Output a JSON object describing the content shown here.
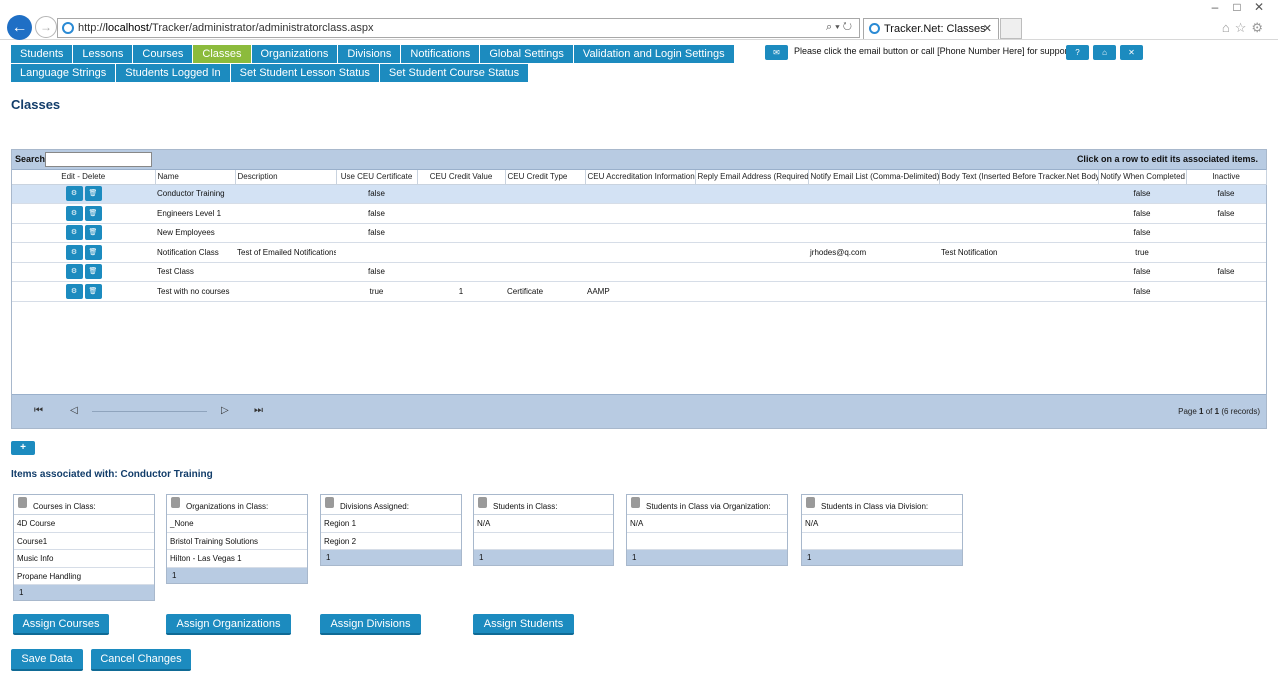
{
  "browser": {
    "url_prefix": "http://",
    "url_host": "localhost",
    "url_path": "/Tracker/administrator/administratorclass.aspx",
    "tab_title": "Tracker.Net: Classes"
  },
  "nav": {
    "row1": [
      "Students",
      "Lessons",
      "Courses",
      "Classes",
      "Organizations",
      "Divisions",
      "Notifications",
      "Global Settings",
      "Validation and Login Settings"
    ],
    "row2": [
      "Language Strings",
      "Students Logged In",
      "Set Student Lesson Status",
      "Set Student Course Status"
    ],
    "active": "Classes"
  },
  "support": {
    "text": "Please click the email button or call [Phone Number Here] for support.",
    "help_label": "?",
    "home_label": "⌂",
    "close_label": "✕"
  },
  "page_title": "Classes",
  "grid": {
    "search_label": "Search:",
    "search_value": "",
    "hint": "Click on a row to edit its associated items.",
    "columns": [
      "Edit - Delete",
      "Name",
      "Description",
      "Use CEU Certificate",
      "CEU Credit Value",
      "CEU Credit Type",
      "CEU Accreditation Information",
      "Reply Email Address (Required)",
      "Notify Email List (Comma-Delimited)",
      "Body Text (Inserted Before Tracker.Net Body)",
      "Notify When Completed",
      "Inactive"
    ],
    "rows": [
      {
        "name": "Conductor Training",
        "description": "",
        "use_ceu": "false",
        "ceu_value": "",
        "ceu_type": "",
        "ceu_accred": "",
        "reply_email": "",
        "notify_list": "",
        "body_text": "",
        "notify_completed": "false",
        "inactive": "false"
      },
      {
        "name": "Engineers Level 1",
        "description": "",
        "use_ceu": "false",
        "ceu_value": "",
        "ceu_type": "",
        "ceu_accred": "",
        "reply_email": "",
        "notify_list": "",
        "body_text": "",
        "notify_completed": "false",
        "inactive": "false"
      },
      {
        "name": "New Employees",
        "description": "",
        "use_ceu": "false",
        "ceu_value": "",
        "ceu_type": "",
        "ceu_accred": "",
        "reply_email": "",
        "notify_list": "",
        "body_text": "",
        "notify_completed": "false",
        "inactive": ""
      },
      {
        "name": "Notification Class",
        "description": "Test of Emailed Notifications",
        "use_ceu": "",
        "ceu_value": "",
        "ceu_type": "",
        "ceu_accred": "",
        "reply_email": "",
        "notify_list": "jrhodes@q.com",
        "body_text": "Test Notification",
        "notify_completed": "true",
        "inactive": ""
      },
      {
        "name": "Test Class",
        "description": "",
        "use_ceu": "false",
        "ceu_value": "",
        "ceu_type": "",
        "ceu_accred": "",
        "reply_email": "",
        "notify_list": "",
        "body_text": "",
        "notify_completed": "false",
        "inactive": "false"
      },
      {
        "name": "Test with no courses",
        "description": "",
        "use_ceu": "true",
        "ceu_value": "1",
        "ceu_type": "Certificate",
        "ceu_accred": "AAMP",
        "reply_email": "",
        "notify_list": "",
        "body_text": "",
        "notify_completed": "false",
        "inactive": ""
      }
    ],
    "pager": {
      "page_label": "Page",
      "page": "1",
      "of_label": "of",
      "total_pages": "1",
      "records": "(6 records)"
    }
  },
  "add_button_label": "+",
  "assoc_title": "Items associated with: Conductor Training",
  "lists": [
    {
      "title": "Courses in Class:",
      "items": [
        "4D Course",
        "Course1",
        "Music Info",
        "Propane Handling"
      ],
      "footer": "1"
    },
    {
      "title": "Organizations in Class:",
      "items": [
        "_None",
        "Bristol Training Solutions",
        "Hilton - Las Vegas 1"
      ],
      "footer": "1"
    },
    {
      "title": "Divisions Assigned:",
      "items": [
        "Region 1",
        "Region 2"
      ],
      "footer": "1"
    },
    {
      "title": "Students in Class:",
      "items": [
        "N/A",
        ""
      ],
      "footer": "1"
    },
    {
      "title": "Students in Class via Organization:",
      "items": [
        "N/A",
        ""
      ],
      "footer": "1"
    },
    {
      "title": "Students in Class via Division:",
      "items": [
        "N/A",
        ""
      ],
      "footer": "1"
    }
  ],
  "buttons": {
    "assign_courses": "Assign Courses",
    "assign_organizations": "Assign Organizations",
    "assign_divisions": "Assign Divisions",
    "assign_students": "Assign Students",
    "save": "Save Data",
    "cancel": "Cancel Changes"
  },
  "colors": {
    "nav_blue": "#1c8bbf",
    "nav_active": "#8cbb3c",
    "grid_band": "#b8cbe2",
    "selected_row": "#d3e2f4",
    "title_navy": "#123d6a"
  }
}
